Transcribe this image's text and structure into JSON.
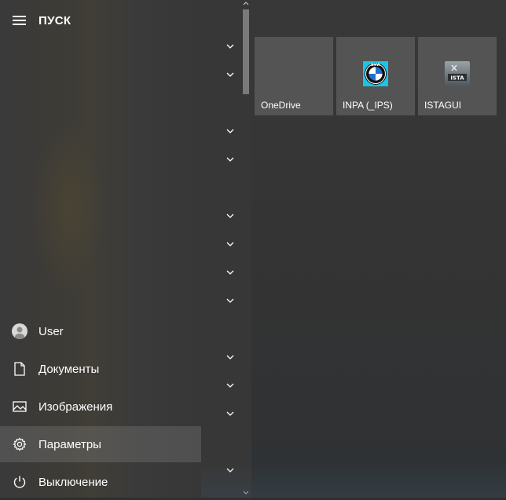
{
  "start_menu": {
    "title": "ПУСК",
    "menu_icon": "hamburger-icon"
  },
  "nav": {
    "items": [
      {
        "label": "User",
        "icon": "user-avatar-icon"
      },
      {
        "label": "Документы",
        "icon": "document-icon"
      },
      {
        "label": "Изображения",
        "icon": "image-icon"
      },
      {
        "label": "Параметры",
        "icon": "gear-icon",
        "active": true
      },
      {
        "label": "Выключение",
        "icon": "power-icon"
      }
    ]
  },
  "app_list": {
    "group_toggles": [
      "chevron-down-icon",
      "chevron-down-icon",
      "chevron-down-icon",
      "chevron-down-icon",
      "chevron-down-icon",
      "chevron-down-icon",
      "chevron-down-icon",
      "chevron-down-icon",
      "chevron-down-icon",
      "chevron-down-icon",
      "chevron-down-icon",
      "chevron-down-icon"
    ]
  },
  "tiles": [
    {
      "label": "OneDrive",
      "icon": ""
    },
    {
      "label": "INPA (_IPS)",
      "icon": "bmw-logo-icon"
    },
    {
      "label": "ISTAGUI",
      "icon": "ista-icon"
    }
  ],
  "colors": {
    "tile_bg": "#545454",
    "active_item_bg": "rgba(255,255,255,0.12)",
    "text": "#ffffff"
  }
}
